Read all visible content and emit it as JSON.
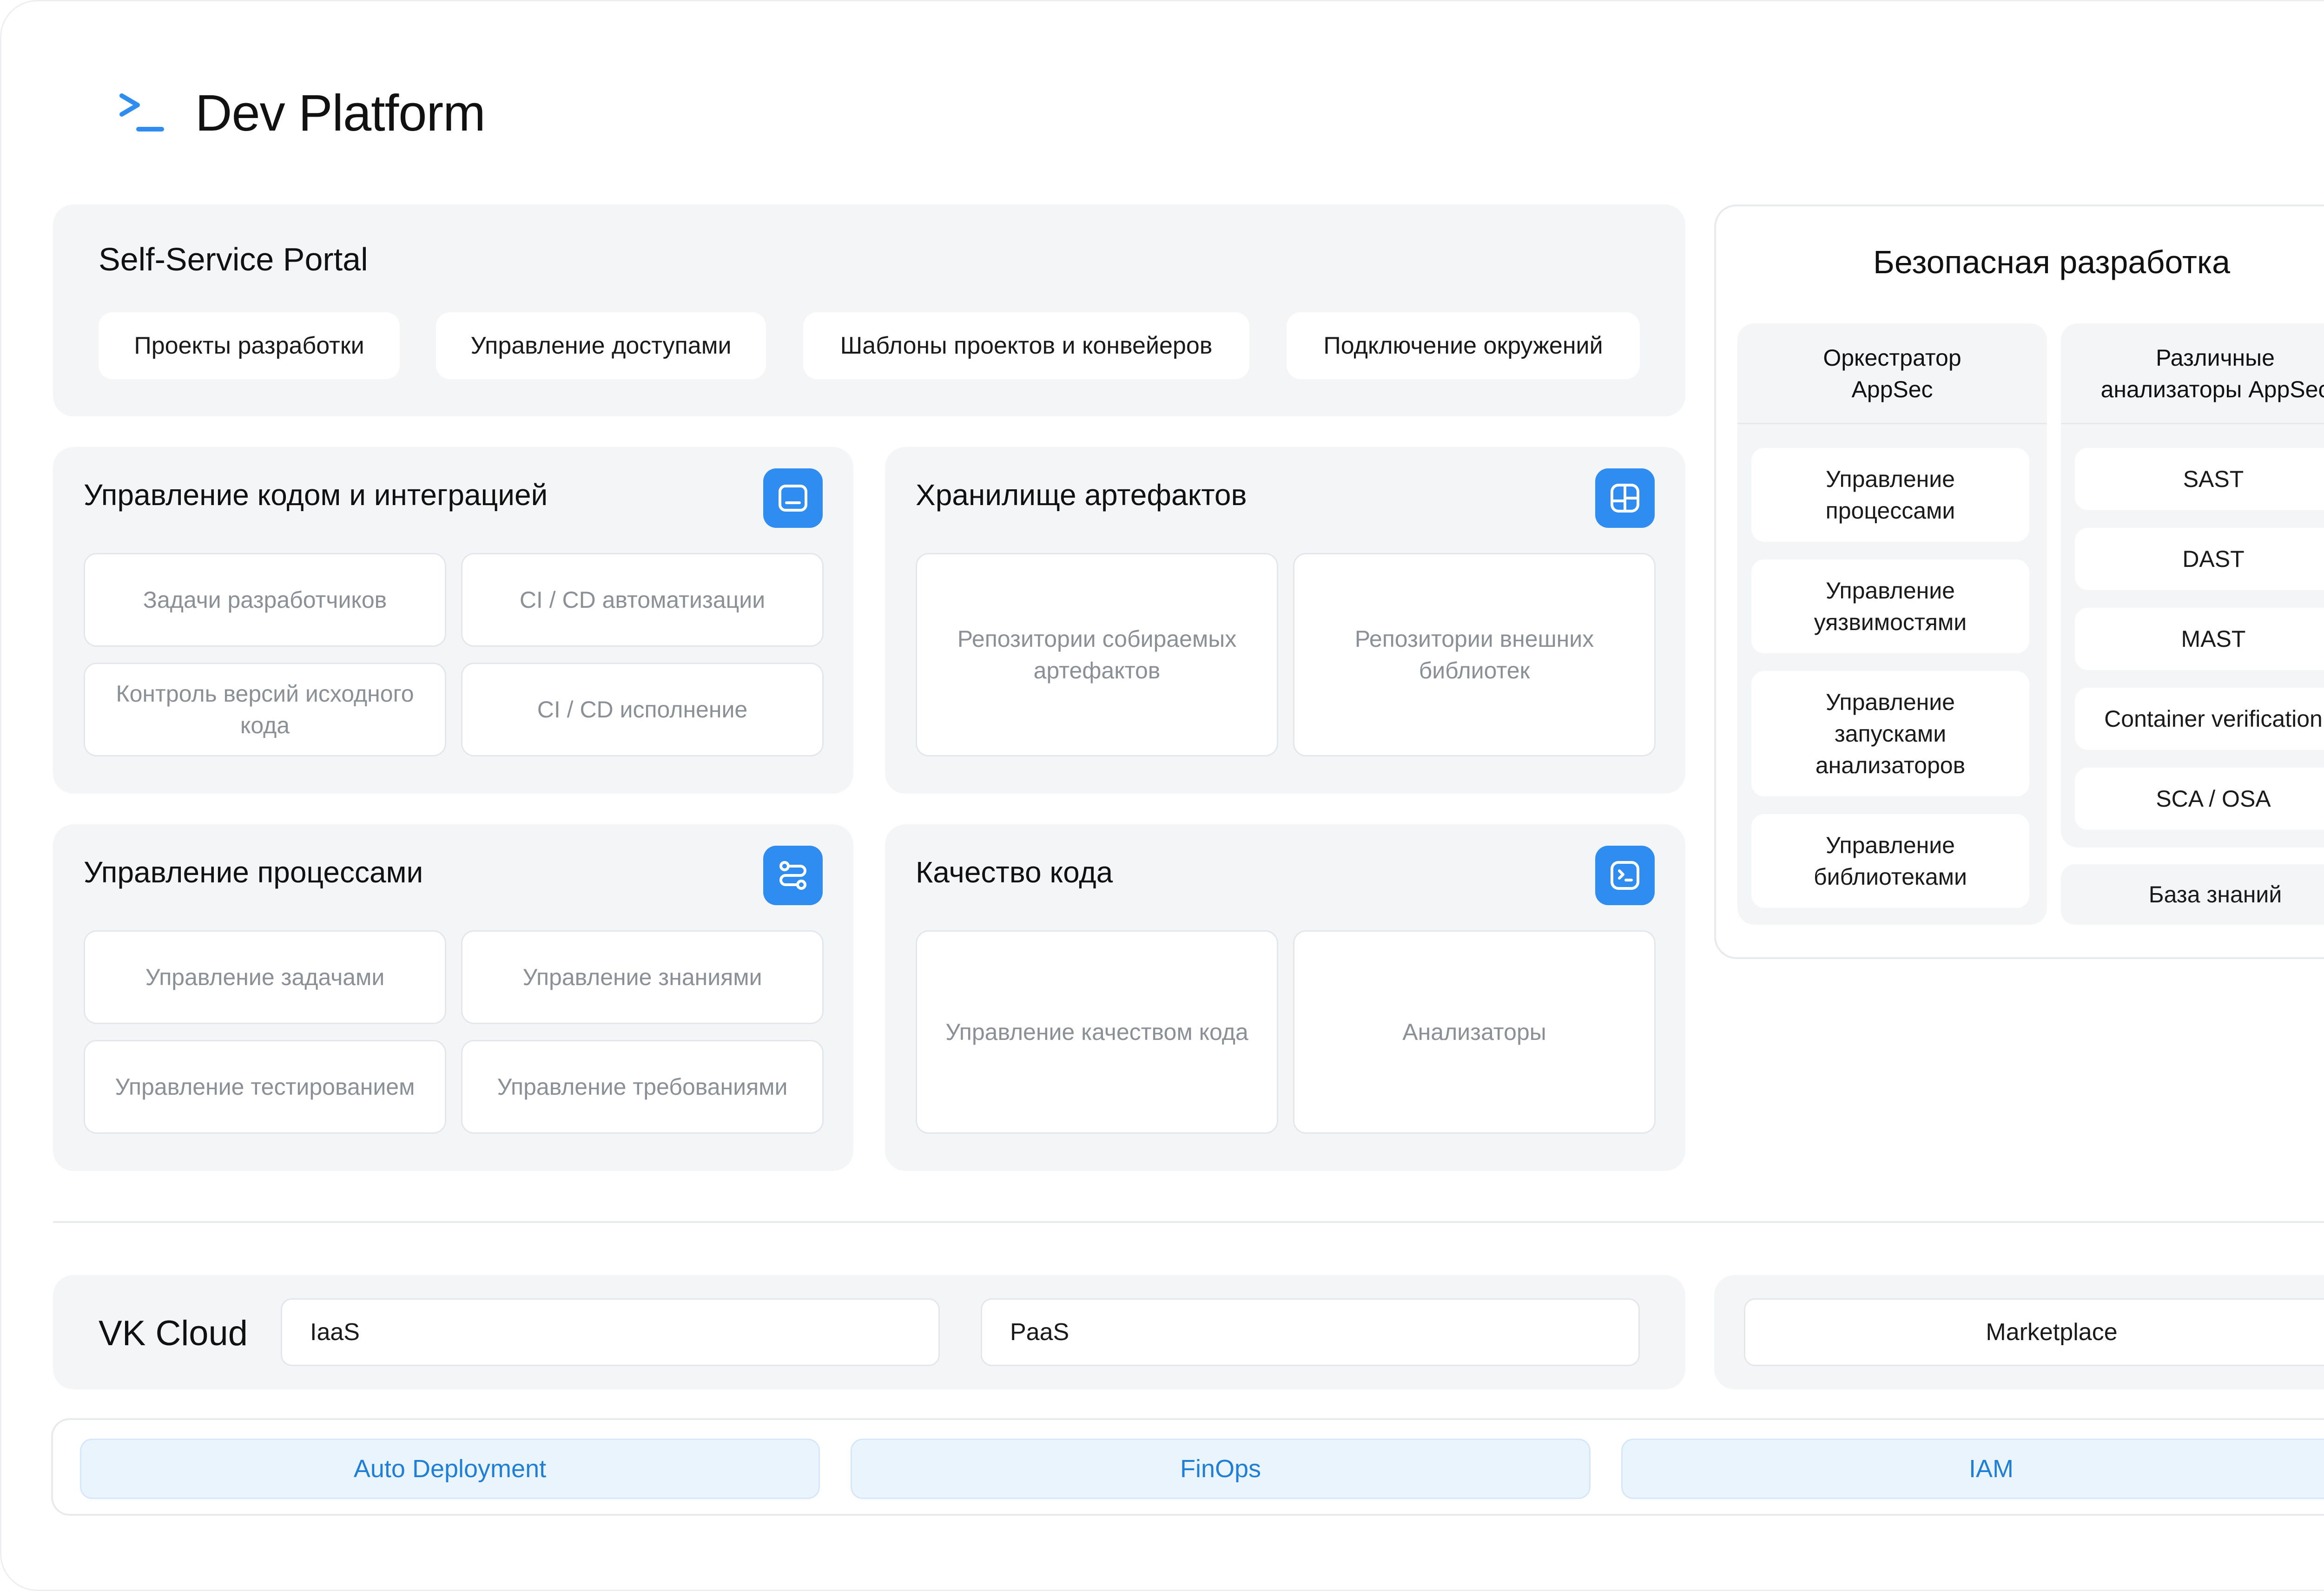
{
  "header": {
    "title": "Dev Platform"
  },
  "self_service": {
    "title": "Self-Service Portal",
    "chips": [
      "Проекты разработки",
      "Управление доступами",
      "Шаблоны проектов и конвейеров",
      "Подключение окружений"
    ]
  },
  "code_mgmt": {
    "title": "Управление кодом и интеграцией",
    "cards": [
      "Задачи разработчиков",
      "CI / CD автоматизации",
      "Контроль версий исходного кода",
      "CI / CD исполнение"
    ]
  },
  "artifacts": {
    "title": "Хранилище артефактов",
    "cards": [
      "Репозитории собираемых артефактов",
      "Репозитории внешних библиотек"
    ]
  },
  "process_mgmt": {
    "title": "Управление процессами",
    "cards": [
      "Управление задачами",
      "Управление знаниями",
      "Управление тестированием",
      "Управление требованиями"
    ]
  },
  "code_quality": {
    "title": "Качество кода",
    "cards": [
      "Управление качеством кода",
      "Анализаторы"
    ]
  },
  "secure_dev": {
    "title": "Безопасная разработка",
    "orchestrator": {
      "title": "Оркестратор AppSec",
      "items": [
        "Управление процессами",
        "Управление уязвимостями",
        "Управление запусками анализаторов",
        "Управление библиотеками"
      ]
    },
    "analyzers": {
      "title": "Различные анализаторы AppSec",
      "items": [
        "SAST",
        "DAST",
        "MAST",
        "Container verification",
        "SCA / OSA"
      ]
    },
    "knowledge_base": "База знаний"
  },
  "vk_cloud": {
    "title": "VK Cloud",
    "iaas": "IaaS",
    "paas": "PaaS",
    "marketplace": "Marketplace"
  },
  "bottom": [
    "Auto Deployment",
    "FinOps",
    "IAM"
  ],
  "colors": {
    "accent": "#2f8cf0",
    "panel": "#f4f5f7",
    "bottom_text": "#1f7fd6"
  }
}
